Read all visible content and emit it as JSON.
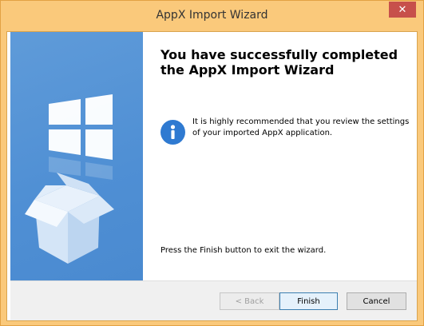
{
  "window": {
    "title": "AppX Import Wizard",
    "close_glyph": "✕"
  },
  "content": {
    "heading": "You have successfully completed the AppX Import Wizard",
    "info_text": "It is highly recommended that you review the settings of your imported AppX application.",
    "exit_text": "Press the Finish button to exit the wizard."
  },
  "buttons": {
    "back": "< Back",
    "finish": "Finish",
    "cancel": "Cancel"
  },
  "icons": {
    "info": "info-icon",
    "windows_logo": "windows-logo-icon",
    "box": "open-box-icon"
  },
  "colors": {
    "titlebar": "#fac97b",
    "side_panel": "#4f8fd4",
    "info_icon": "#2f7ad1",
    "close_button": "#c7504b"
  }
}
